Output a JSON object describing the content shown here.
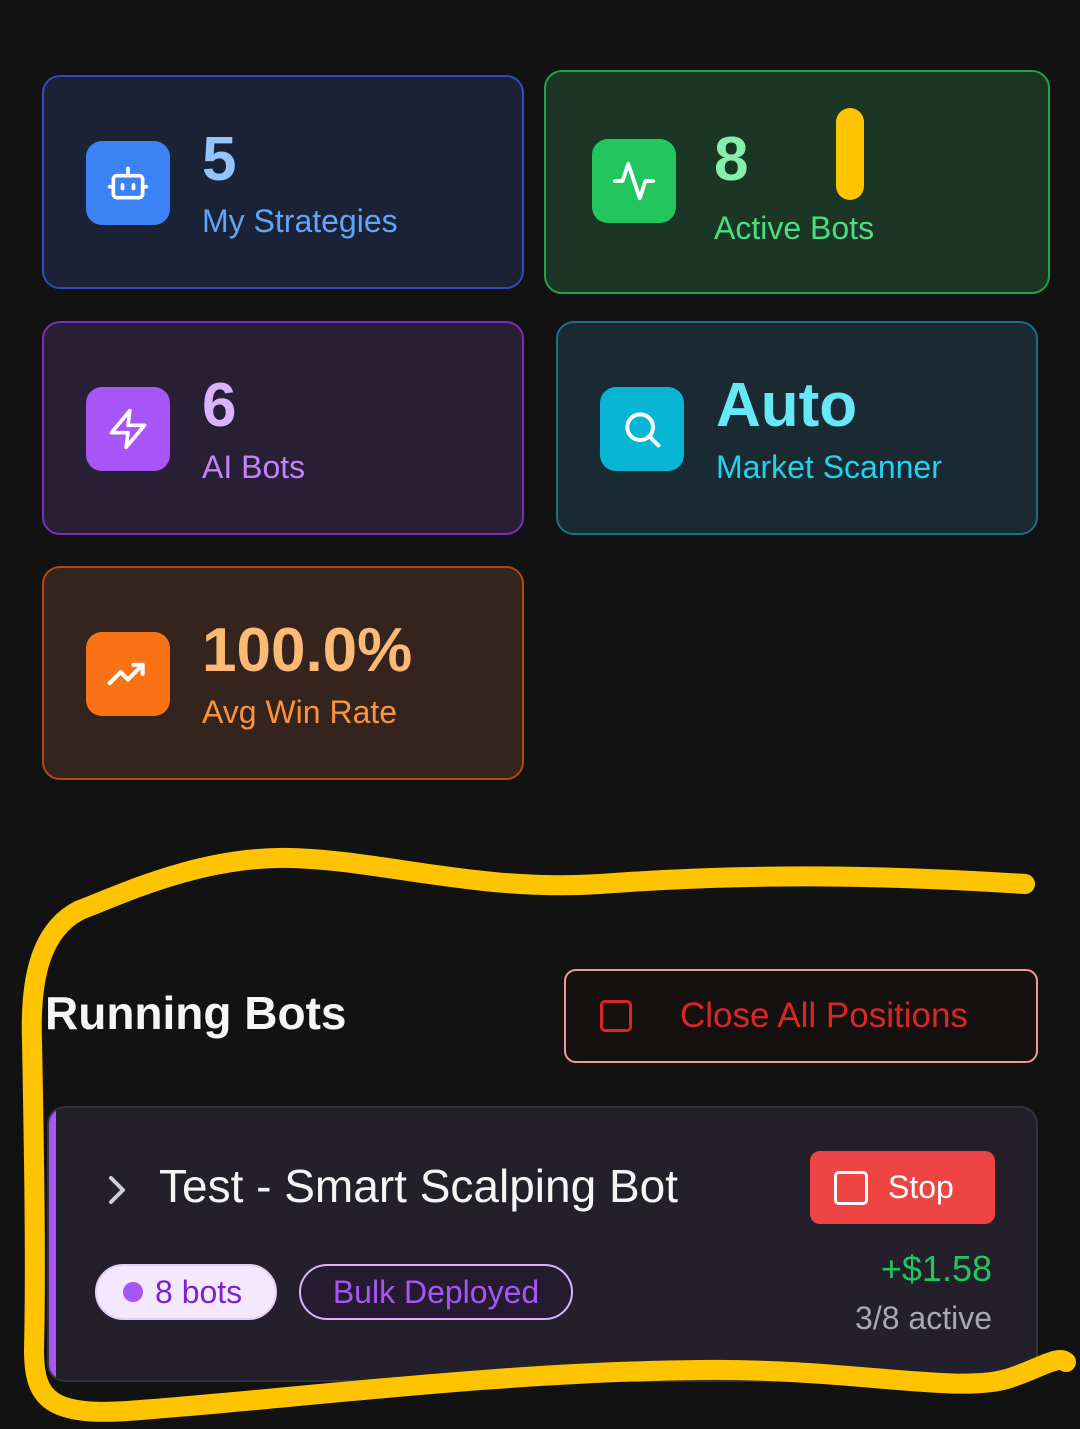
{
  "stats": [
    {
      "id": "c1",
      "value": "5",
      "label": "My Strategies",
      "icon": "robot-icon"
    },
    {
      "id": "c2",
      "value": "8",
      "label": "Active Bots",
      "icon": "activity-icon"
    },
    {
      "id": "c3",
      "value": "6",
      "label": "AI Bots",
      "icon": "lightning-icon"
    },
    {
      "id": "c4",
      "value": "Auto",
      "label": "Market Scanner",
      "icon": "search-icon"
    },
    {
      "id": "c5",
      "value": "100.0%",
      "label": "Avg Win Rate",
      "icon": "trending-up-icon"
    }
  ],
  "running": {
    "title": "Running Bots",
    "close_all_label": "Close All Positions",
    "bot": {
      "name": "Test - Smart Scalping Bot",
      "stop_label": "Stop",
      "count_badge": "8 bots",
      "deploy_badge": "Bulk Deployed",
      "pnl": "+$1.58",
      "active": "3/8 active"
    }
  },
  "colors": {
    "accent_purple": "#a855f7",
    "danger": "#ef4444",
    "profit": "#22c55e",
    "annotation": "#ffc400"
  }
}
